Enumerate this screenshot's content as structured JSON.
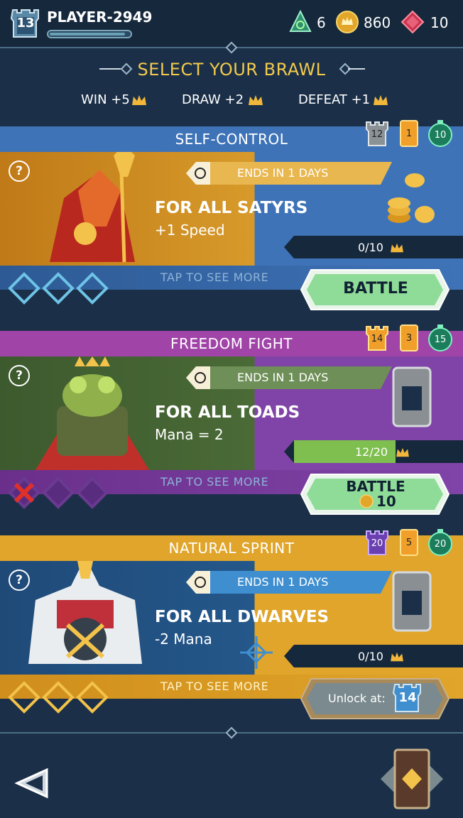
{
  "header": {
    "level": "13",
    "player_name": "PLAYER-2949",
    "xp_progress": 0.95,
    "resources": {
      "mana": "6",
      "gold": "860",
      "gems": "10"
    }
  },
  "title": "SELECT YOUR BRAWL",
  "rewards": {
    "win": "WIN +5",
    "draw": "DRAW +2",
    "defeat": "DEFEAT +1"
  },
  "events": [
    {
      "name": "SELF-CONTROL",
      "tower_level": "12",
      "card_count": "1",
      "timer": "10",
      "ends": "ENDS IN 1 DAYS",
      "for_all": "FOR ALL SATYRS",
      "effect": "+1 Speed",
      "progress": "0/10",
      "progress_value": 0,
      "tap_more": "TAP TO SEE MORE",
      "action": "BATTLE"
    },
    {
      "name": "FREEDOM FIGHT",
      "tower_level": "14",
      "card_count": "3",
      "timer": "15",
      "ends": "ENDS IN 1 DAYS",
      "for_all": "FOR ALL TOADS",
      "effect": "Mana = 2",
      "progress": "12/20",
      "progress_value": 0.6,
      "tap_more": "TAP TO SEE MORE",
      "action": "BATTLE",
      "action_cost": "10"
    },
    {
      "name": "NATURAL SPRINT",
      "tower_level": "20",
      "card_count": "5",
      "timer": "20",
      "ends": "ENDS IN 1 DAYS",
      "for_all": "FOR ALL DWARVES",
      "effect": "-2 Mana",
      "progress": "0/10",
      "progress_value": 0,
      "tap_more": "TAP TO SEE MORE",
      "unlock_label": "Unlock at:",
      "unlock_level": "14"
    }
  ],
  "colors": {
    "background": "#1b3048",
    "gold_title": "#f2c94c",
    "banner_blue": "#3f73b8",
    "banner_magenta": "#a044a8",
    "banner_gold": "#e0a52a",
    "battle_green": "#9fe3a4"
  }
}
